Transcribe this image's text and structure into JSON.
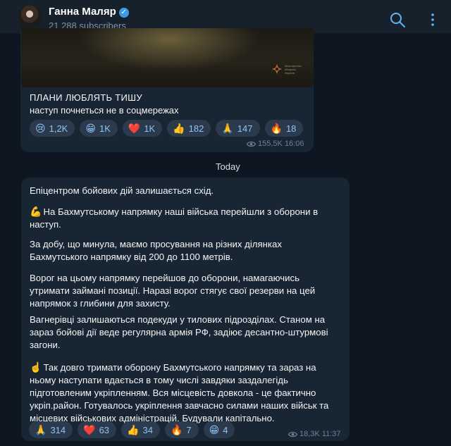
{
  "channel": {
    "name": "Ганна Маляр",
    "subscribers": "21 288 subscribers"
  },
  "post1": {
    "media_emblem_text": "Міністерство оборони України",
    "caption_title": "ПЛАНИ ЛЮБЛЯТЬ ТИШУ",
    "caption_sub": "наступ почнеться не в соцмережах",
    "reactions": [
      {
        "emoji": "😢",
        "count": "1,2K"
      },
      {
        "emoji": "😁",
        "count": "1K"
      },
      {
        "emoji": "❤️",
        "count": "1K"
      },
      {
        "emoji": "👍",
        "count": "182"
      },
      {
        "emoji": "🙏",
        "count": "147"
      },
      {
        "emoji": "🔥",
        "count": "18"
      }
    ],
    "views": "155,5K",
    "time": "16:06"
  },
  "date_separator": "Today",
  "post2": {
    "paragraphs": [
      {
        "emoji": "",
        "text": "Епіцентром бойових дій залишається схід."
      },
      {
        "emoji": "💪",
        "text": "На Бахмутському напрямку наші війська перейшли з оборони в наступ."
      },
      {
        "emoji": "",
        "text": "За добу, що минула, маємо просування на різних ділянках Бахмутського напрямку від 200 до 1100 метрів."
      },
      {
        "emoji": "",
        "text": "Ворог на цьому напрямку перейшов до оборони, намагаючись утримати займані позиції. Наразі ворог стягує свої резерви на цей напрямок з глибини для захисту."
      },
      {
        "emoji": "",
        "text": "Вагнерівці залишаються подекуди у тилових підрозділах. Станом на зараз бойові дії веде регулярна армія РФ, задіює десантно-штурмові загони."
      },
      {
        "emoji": "☝️",
        "text": "Так довго тримати оборону Бахмутського напрямку та зараз на ньому наступати  вдається в тому числі завдяки заздалегідь підготовленим укріпленням. Вся місцевість довкола - це фактично укріп.район. Готувалось укріплення завчасно силами наших військ та місцевих військових адміністрацій. Будували капітально."
      }
    ],
    "reactions": [
      {
        "emoji": "🙏",
        "count": "314"
      },
      {
        "emoji": "❤️",
        "count": "63"
      },
      {
        "emoji": "👍",
        "count": "34"
      },
      {
        "emoji": "🔥",
        "count": "7"
      },
      {
        "emoji": "😁",
        "count": "4"
      }
    ],
    "views": "18,3K",
    "time": "11:37"
  },
  "colors": {
    "background": "#0e1621",
    "header": "#17212b",
    "bubble": "#182533",
    "accent": "#5eb5f7",
    "reaction_chip": "#2b3a4c"
  },
  "icons": [
    "verified-icon",
    "search-icon",
    "more-icon",
    "eye-icon",
    "emblem-icon"
  ]
}
